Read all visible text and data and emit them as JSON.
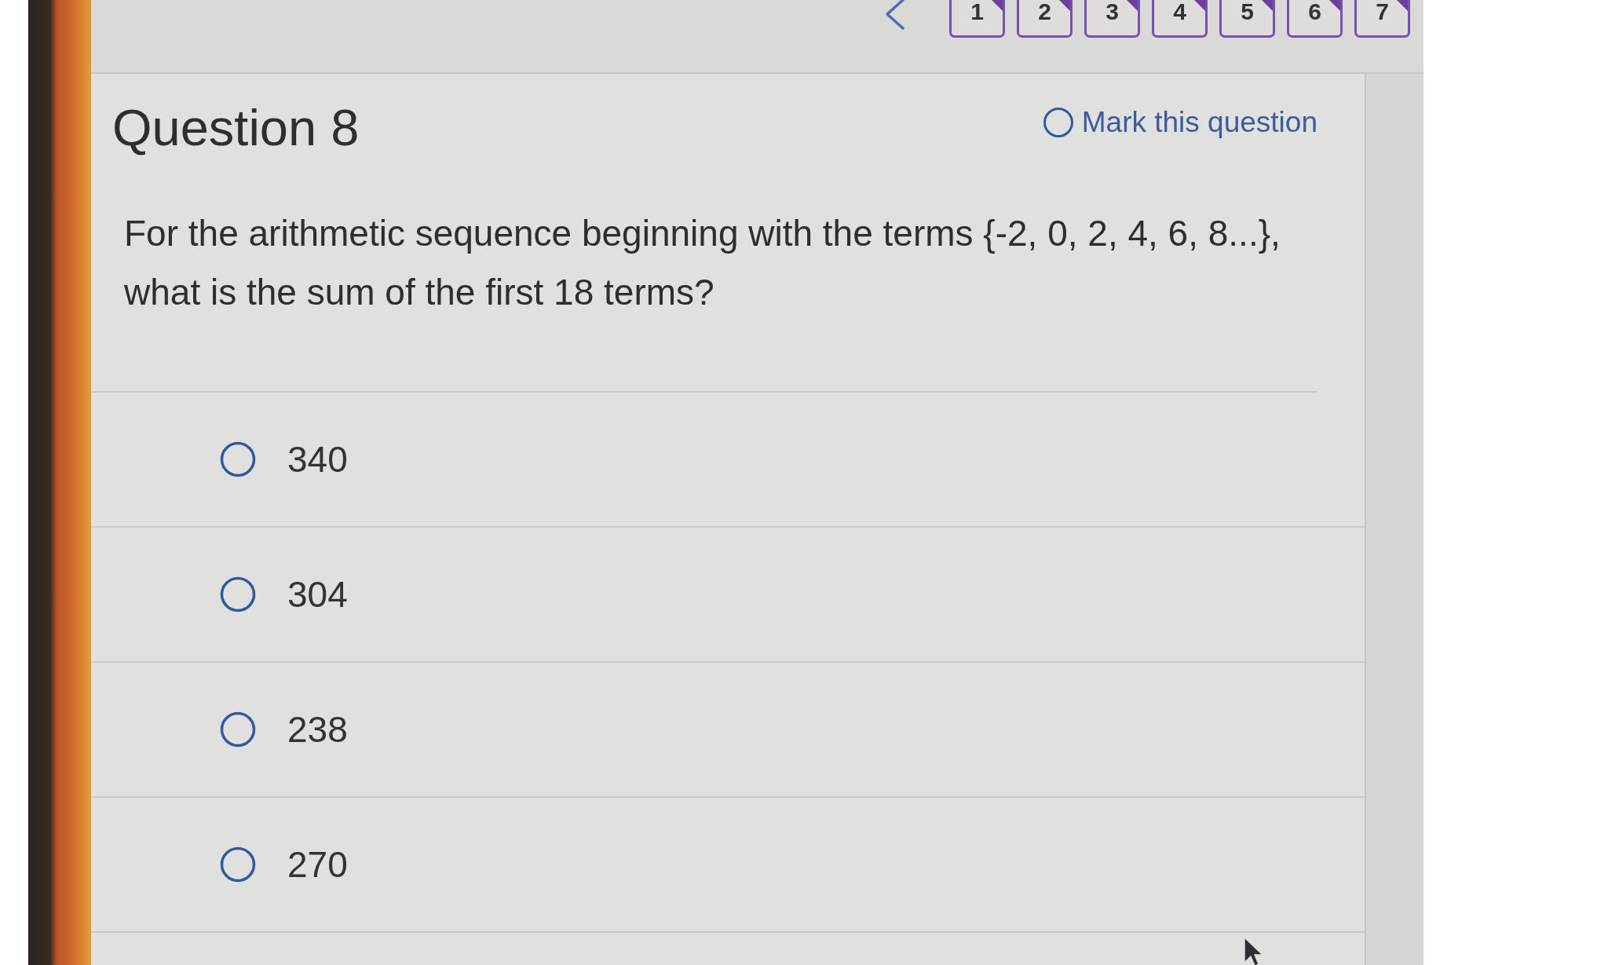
{
  "nav": {
    "pages": [
      {
        "label": "1",
        "answered": true
      },
      {
        "label": "2",
        "answered": true
      },
      {
        "label": "3",
        "answered": true
      },
      {
        "label": "4",
        "answered": true
      },
      {
        "label": "5",
        "answered": true
      },
      {
        "label": "6",
        "answered": true
      },
      {
        "label": "7",
        "answered": true
      }
    ]
  },
  "question": {
    "title": "Question 8",
    "mark": {
      "label": "Mark this question",
      "marked": false
    },
    "text": "For the arithmetic sequence beginning with the terms {-2, 0, 2, 4, 6, 8...}, what is the sum of the first 18 terms?",
    "options": [
      {
        "label": "340",
        "selected": false
      },
      {
        "label": "304",
        "selected": false
      },
      {
        "label": "238",
        "selected": false
      },
      {
        "label": "270",
        "selected": false
      }
    ]
  }
}
